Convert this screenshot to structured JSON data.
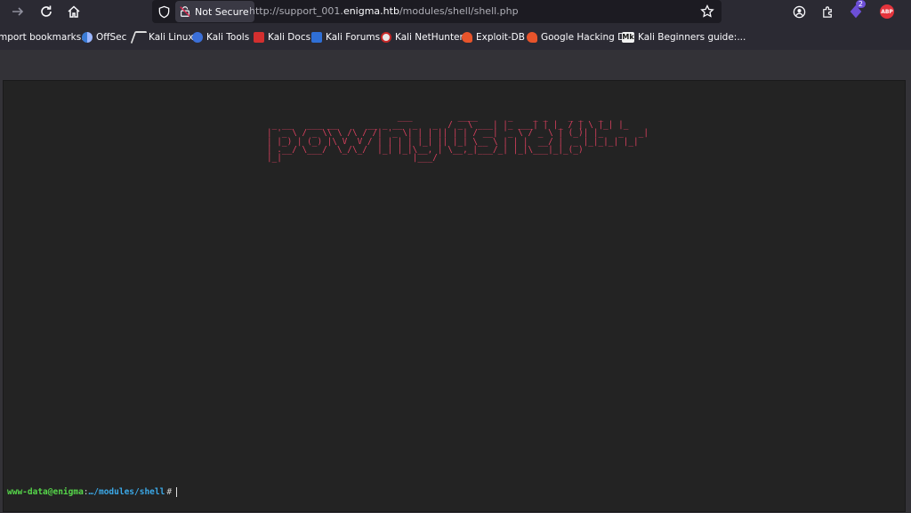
{
  "toolbar": {
    "not_secure_label": "Not Secure",
    "url_prefix": "http://support_001.",
    "url_host": "enigma.htb",
    "url_path": "/modules/shell/shell.php",
    "extension_badge": "2",
    "abp_label": "ABP"
  },
  "bookmarks": [
    {
      "label": "mport bookmarks...",
      "icon": "none"
    },
    {
      "label": "OffSec",
      "icon": "offsec-icon"
    },
    {
      "label": "Kali Linux",
      "icon": "kali-dragon-icon"
    },
    {
      "label": "Kali Tools",
      "icon": "kali-tools-icon"
    },
    {
      "label": "Kali Docs",
      "icon": "kali-docs-icon"
    },
    {
      "label": "Kali Forums",
      "icon": "kali-forums-icon"
    },
    {
      "label": "Kali NetHunter",
      "icon": "nethunter-icon"
    },
    {
      "label": "Exploit-DB",
      "icon": "exploit-db-icon"
    },
    {
      "label": "Google Hacking DB",
      "icon": "ghdb-icon"
    },
    {
      "label": "Kali Beginners guide:...",
      "icon": "mk-icon"
    }
  ],
  "terminal": {
    "banner": "                          ___         ____      _    _ _    _ _   _   \n _ __   ___ __      __ _ __  _   _  / _ \\ ___| |_ ___| | |_ / | \\ |_| |_ \n| '_ \\ / _ \\\\ \\ /\\ / /| '_ \\| | | || | | / __| '_ \\ / _ \\ | (_)| |_   _   _|\n| |_) | (_) |\\ V  V / | | | | |_| || |_| \\__ \\ | | |  __/ |  _ |_|_|_| |_|\n| .__/ \\___/  \\_/\\_/  |_| |_|\\__, | \\__,_|___/_| |_|\\___|_|_(_)          \n|_|                          |___/                                       ",
    "prompt_user": "www-data@enigma",
    "prompt_sep": ":",
    "prompt_path": "…/modules/shell",
    "prompt_hash": "#"
  },
  "colors": {
    "banner": "#d9405e",
    "prompt_user": "#56d64a",
    "prompt_path": "#3ba9e8",
    "terminal_bg": "#232323"
  }
}
